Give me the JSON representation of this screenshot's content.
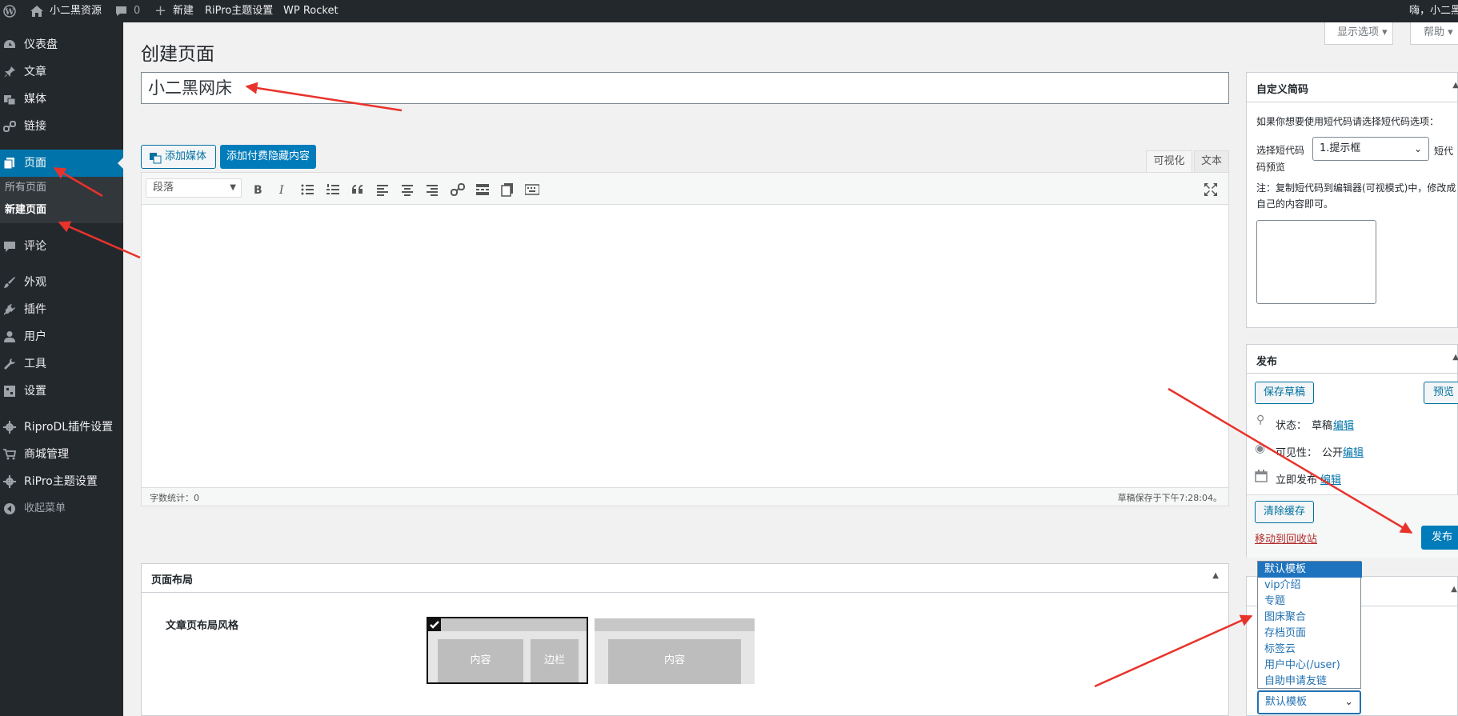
{
  "adminbar": {
    "site_name": "小二黑资源",
    "comments_count": "0",
    "new_label": "新建",
    "ripro_settings": "RiPro主题设置",
    "wp_rocket": "WP Rocket",
    "greeting": "嗨，小二黑"
  },
  "sidebar": {
    "items": [
      {
        "label": "仪表盘",
        "icon": "dashboard-icon"
      },
      {
        "label": "文章",
        "icon": "pin-icon"
      },
      {
        "label": "媒体",
        "icon": "media-icon"
      },
      {
        "label": "链接",
        "icon": "link-icon"
      },
      {
        "label": "页面",
        "icon": "page-icon"
      },
      {
        "label": "评论",
        "icon": "comment-icon"
      },
      {
        "label": "外观",
        "icon": "brush-icon"
      },
      {
        "label": "插件",
        "icon": "plugin-icon"
      },
      {
        "label": "用户",
        "icon": "user-icon"
      },
      {
        "label": "工具",
        "icon": "wrench-icon"
      },
      {
        "label": "设置",
        "icon": "settings-icon"
      },
      {
        "label": "RiproDL插件设置",
        "icon": "gear-icon"
      },
      {
        "label": "商城管理",
        "icon": "cart-icon"
      },
      {
        "label": "RiPro主题设置",
        "icon": "gear-icon"
      },
      {
        "label": "收起菜单",
        "icon": "collapse-icon"
      }
    ],
    "pages_submenu": [
      "所有页面",
      "新建页面"
    ]
  },
  "screen_options": "显示选项",
  "help": "帮助",
  "page_title": "创建页面",
  "title_value": "小二黑网床",
  "editor": {
    "add_media": "添加媒体",
    "add_paid": "添加付费隐藏内容",
    "tab_visual": "可视化",
    "tab_text": "文本",
    "format_select": "段落",
    "word_count": "字数统计：0",
    "draft_saved": "草稿保存于下午7:28:04。"
  },
  "layout_box": {
    "title": "页面布局",
    "label": "文章页布局风格",
    "opt1_content": "内容",
    "opt1_sidebar": "边栏",
    "opt2_content": "内容"
  },
  "shortcode_box": {
    "title": "自定义简码",
    "desc": "如果你想要使用短代码请选择短代码选项：",
    "select_label": "选择短代码",
    "select_value": "1.提示框",
    "preview_label": "短代码预览",
    "note": "注：复制短代码到编辑器(可视模式)中，修改成自己的内容即可。"
  },
  "publish_box": {
    "title": "发布",
    "save_draft": "保存草稿",
    "preview": "预览",
    "status_label": "状态：",
    "status_value": "草稿",
    "visibility_label": "可见性：",
    "visibility_value": "公开",
    "publish_time": "立即发布",
    "edit": "编辑",
    "clear_cache": "清除缓存",
    "trash": "移动到回收站",
    "publish": "发布"
  },
  "template_dropdown": {
    "options": [
      "默认模板",
      "vip介绍",
      "专题",
      "图床聚合",
      "存档页面",
      "标签云",
      "用户中心(/user)",
      "自助申请友链"
    ],
    "selected": "默认模板"
  },
  "colors": {
    "admin_dark": "#23282d",
    "accent": "#0073aa",
    "annotation": "#e8332b"
  }
}
